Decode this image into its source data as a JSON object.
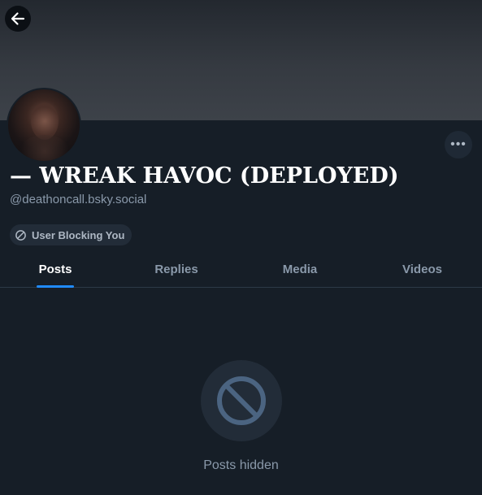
{
  "profile": {
    "display_name": "— WREAK HAVOC (DEPLOYED)",
    "handle": "@deathoncall.bsky.social",
    "blocking_badge": "User Blocking You"
  },
  "tabs": [
    {
      "label": "Posts",
      "active": true
    },
    {
      "label": "Replies",
      "active": false
    },
    {
      "label": "Media",
      "active": false
    },
    {
      "label": "Videos",
      "active": false
    }
  ],
  "empty_state": {
    "message": "Posts hidden",
    "icon": "ban-icon"
  },
  "colors": {
    "background": "#161e27",
    "accent": "#208bfe",
    "muted_text": "#8a99aa"
  }
}
